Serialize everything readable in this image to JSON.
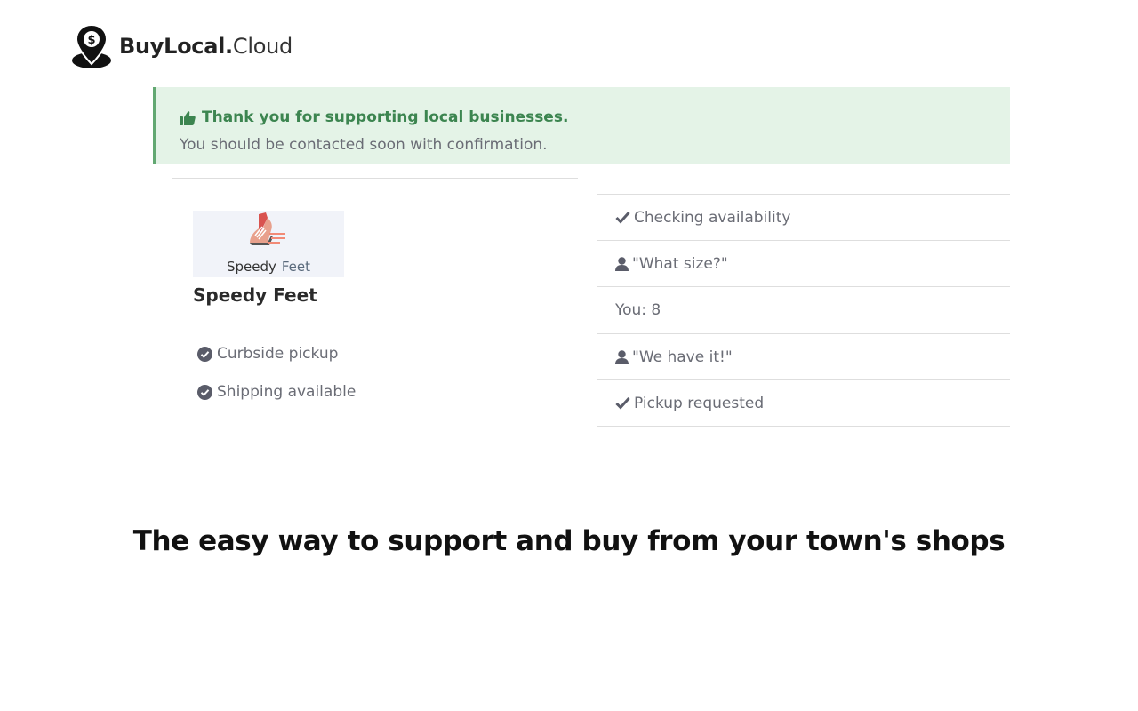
{
  "brand": {
    "name_bold": "BuyLocal.",
    "name_light": "Cloud",
    "logo_icon": "location-pin-dollar-icon"
  },
  "alert": {
    "icon": "thumbs-up-icon",
    "title": "Thank you for supporting local businesses.",
    "message": "You should be contacted soon with confirmation.",
    "accent_color": "#62a872",
    "background_color": "#e4f3e7"
  },
  "store": {
    "logo_icon": "running-shoe-icon",
    "logo_text_1": "Speedy",
    "logo_text_2": "Feet",
    "name": "Speedy Feet",
    "features": [
      {
        "icon": "check-circle-icon",
        "label": "Curbside pickup"
      },
      {
        "icon": "check-circle-icon",
        "label": "Shipping available"
      }
    ]
  },
  "conversation": [
    {
      "icon": "check-icon",
      "text": "Checking availability"
    },
    {
      "icon": "user-icon",
      "text": "\"What size?\""
    },
    {
      "icon": "",
      "text": "You: 8"
    },
    {
      "icon": "user-icon",
      "text": "\"We have it!\""
    },
    {
      "icon": "check-icon",
      "text": "Pickup requested"
    }
  ],
  "tagline": "The easy way to support and buy from your town's shops"
}
